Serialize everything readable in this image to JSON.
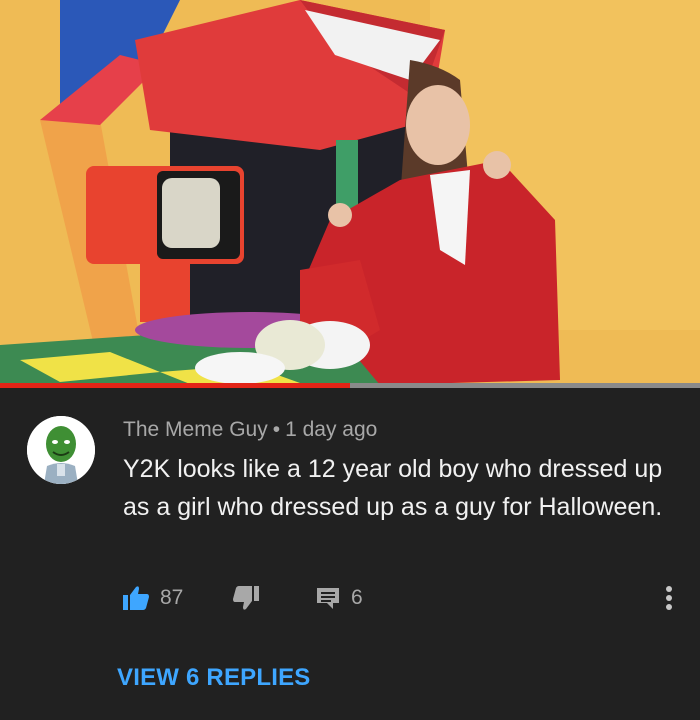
{
  "video": {
    "progress_fraction": 0.5,
    "progress_color": "#e32417"
  },
  "comment": {
    "author": "The Meme Guy",
    "separator": "•",
    "timestamp": "1 day ago",
    "text": "Y2K looks like a 12 year old boy who dressed up as a girl who dressed up as a guy for Halloween.",
    "likes": "87",
    "replies_count": "6",
    "view_replies_label": "VIEW 6 REPLIES",
    "icons": {
      "like": "thumbs-up-icon",
      "dislike": "thumbs-down-icon",
      "reply": "comment-reply-icon",
      "more": "more-vertical-icon"
    },
    "accent_color": "#3ea6ff"
  }
}
